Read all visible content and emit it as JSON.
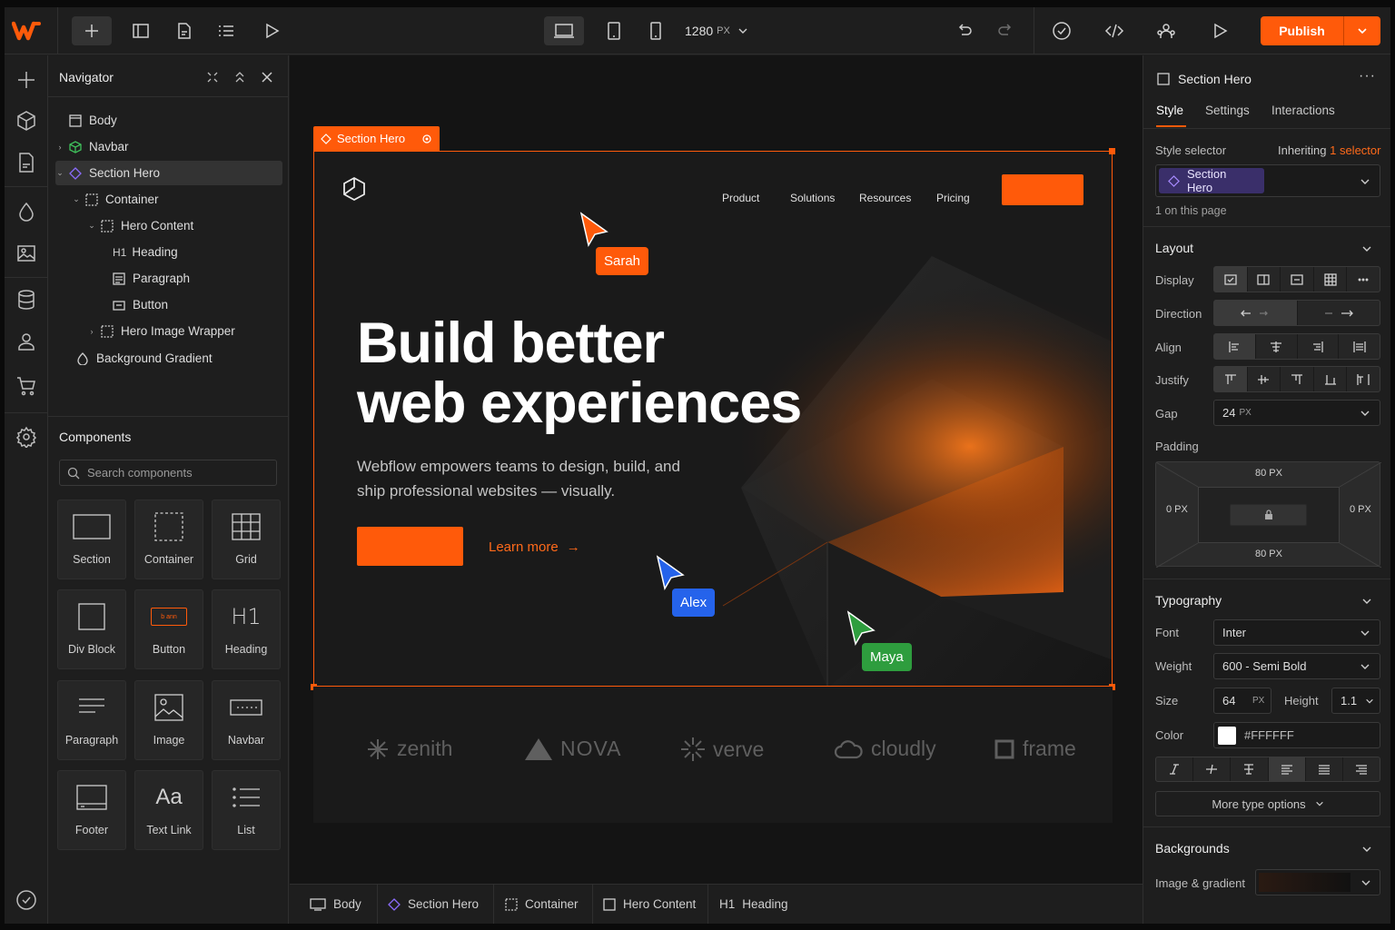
{
  "topbar": {
    "width_value": "1280",
    "width_unit": "PX",
    "publish_label": "Publish"
  },
  "navigator": {
    "title": "Navigator",
    "tree": [
      {
        "label": "Body"
      },
      {
        "label": "Navbar"
      },
      {
        "label": "Section Hero"
      },
      {
        "label": "Container"
      },
      {
        "label": "Hero Content"
      },
      {
        "label": "Heading",
        "prefix": "H1"
      },
      {
        "label": "Paragraph"
      },
      {
        "label": "Button"
      },
      {
        "label": "Hero Image Wrapper"
      },
      {
        "label": "Background Gradient"
      }
    ]
  },
  "components": {
    "title": "Components",
    "search_placeholder": "Search components",
    "items": [
      "Section",
      "Container",
      "Grid",
      "Div Block",
      "Button",
      "Heading",
      "Paragraph",
      "Image",
      "Navbar",
      "Footer",
      "Text Link",
      "List"
    ],
    "button_preview_text": "b ann",
    "heading_glyph": "H1",
    "textlink_glyph": "Aa"
  },
  "canvas": {
    "tag": "Section Hero",
    "menu": [
      "Product",
      "Solutions",
      "Resources",
      "Pricing"
    ],
    "headline_1": "Build better",
    "headline_2": "web experiences",
    "subtext": "Webflow empowers teams to design, build, and ship professional websites — visually.",
    "learn_more": "Learn more",
    "learn_more_arrow": "→",
    "logos": [
      "zenith",
      "NOVA",
      "verve",
      "cloudly",
      "frame"
    ],
    "cursors": [
      {
        "name": "Sarah",
        "color": "#ff5a0a"
      },
      {
        "name": "Alex",
        "color": "#2563eb"
      },
      {
        "name": "Maya",
        "color": "#2e9d3e"
      }
    ]
  },
  "breadcrumb": [
    {
      "label": "Body"
    },
    {
      "label": "Section Hero"
    },
    {
      "label": "Container"
    },
    {
      "label": "Hero Content"
    },
    {
      "label": "Heading",
      "prefix": "H1"
    }
  ],
  "style_panel": {
    "element": "Section Hero",
    "more": "···",
    "tabs": [
      "Style",
      "Settings",
      "Interactions"
    ],
    "style_selector_label": "Style selector",
    "inheriting_text": "Inheriting",
    "inheriting_count": "1 selector",
    "selector_chip": "Section Hero",
    "on_page": "1 on this page",
    "layout": {
      "title": "Layout",
      "display_label": "Display",
      "direction_label": "Direction",
      "align_label": "Align",
      "justify_label": "Justify",
      "gap_label": "Gap",
      "gap_value": "24",
      "gap_unit": "PX",
      "padding_label": "Padding",
      "padding_top": "80 PX",
      "padding_bottom": "80 PX",
      "padding_left": "0 PX",
      "padding_right": "0 PX"
    },
    "typography": {
      "title": "Typography",
      "font_label": "Font",
      "font_value": "Inter",
      "weight_label": "Weight",
      "weight_value": "600 - Semi Bold",
      "size_label": "Size",
      "size_value": "64",
      "size_unit": "PX",
      "height_label": "Height",
      "height_value": "1.1",
      "color_label": "Color",
      "color_value": "#FFFFFF",
      "more_options": "More type options"
    },
    "backgrounds": {
      "title": "Backgrounds",
      "image_gradient_label": "Image & gradient"
    }
  },
  "colors": {
    "accent": "#ff5a0a",
    "panel": "#1e1e1e",
    "canvas": "#141414"
  }
}
